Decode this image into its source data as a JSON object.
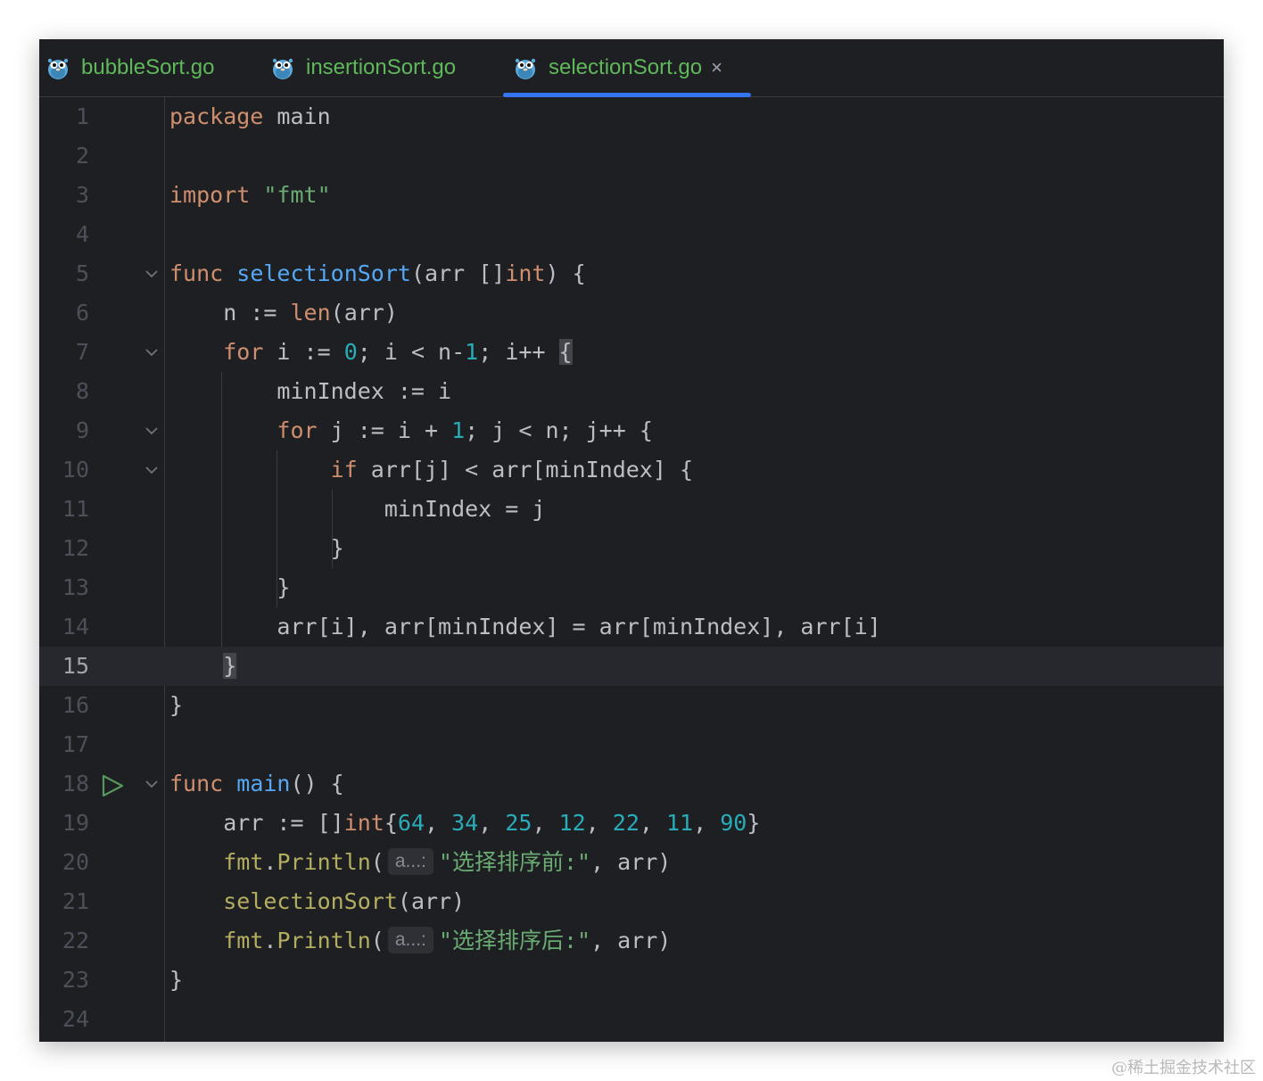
{
  "tabs": [
    {
      "label": "bubbleSort.go",
      "icon": "gopher-icon",
      "active": false
    },
    {
      "label": "insertionSort.go",
      "icon": "gopher-icon",
      "active": false
    },
    {
      "label": "selectionSort.go",
      "icon": "gopher-icon",
      "active": true,
      "close": "×"
    }
  ],
  "editor": {
    "current_line": 15,
    "line_numbers": [
      "1",
      "2",
      "3",
      "4",
      "5",
      "6",
      "7",
      "8",
      "9",
      "10",
      "11",
      "12",
      "13",
      "14",
      "15",
      "16",
      "17",
      "18",
      "19",
      "20",
      "21",
      "22",
      "23",
      "24"
    ],
    "tokens": {
      "l1": [
        "package",
        " ",
        "main"
      ],
      "l3": [
        "import",
        " ",
        "\"fmt\""
      ],
      "l5": [
        "func",
        " ",
        "selectionSort",
        "(arr []",
        "int",
        ") {"
      ],
      "l6": [
        "n := ",
        "len",
        "(arr)"
      ],
      "l7": [
        "for",
        " i := ",
        "0",
        "; i < n-",
        "1",
        "; i++ ",
        "{"
      ],
      "l8": [
        "minIndex := i"
      ],
      "l9": [
        "for",
        " j := i + ",
        "1",
        "; j < n; j++ {"
      ],
      "l10": [
        "if",
        " arr[j] < arr[minIndex] {"
      ],
      "l11": [
        "minIndex = j"
      ],
      "l12": [
        "}"
      ],
      "l13": [
        "}"
      ],
      "l14": [
        "arr[i], arr[minIndex] = arr[minIndex], arr[i]"
      ],
      "l15": [
        "}"
      ],
      "l16": [
        "}"
      ],
      "l18": [
        "func",
        " ",
        "main",
        "() {"
      ],
      "l19": [
        "arr := []",
        "int",
        "{",
        "64",
        ", ",
        "34",
        ", ",
        "25",
        ", ",
        "12",
        ", ",
        "22",
        ", ",
        "11",
        ", ",
        "90",
        "}"
      ],
      "l20": [
        "fmt",
        ".",
        "Println",
        "(",
        "a...:",
        "\"选择排序前:\"",
        ", arr)"
      ],
      "l21": [
        "selectionSort",
        "(arr)"
      ],
      "l22": [
        "fmt",
        ".",
        "Println",
        "(",
        "a...:",
        "\"选择排序后:\"",
        ", arr)"
      ],
      "l23": [
        "}"
      ]
    },
    "icons": {
      "fold": "chevron-down-icon",
      "run": "run-icon"
    }
  },
  "watermark": "@稀土掘金技术社区",
  "colors": {
    "background": "#1e1f22",
    "keyword": "#cf8e6d",
    "function": "#56a8f5",
    "number": "#2aacb8",
    "string": "#6aab73",
    "default": "#bcbec4",
    "tab_text": "#5fb85a",
    "tab_underline": "#3574f0"
  }
}
